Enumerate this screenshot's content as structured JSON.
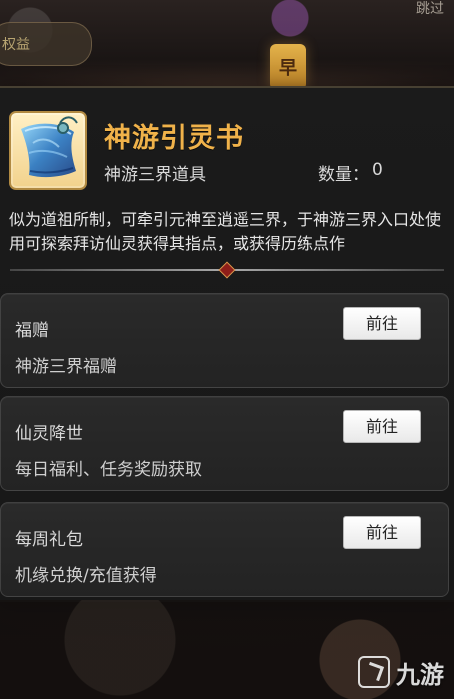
{
  "top": {
    "left_text": "权益",
    "right_text": "跳过",
    "tag_text": "早"
  },
  "item": {
    "name": "神游引灵书",
    "type": "神游三界道具",
    "quantity_label": "数量：",
    "quantity_value": "0",
    "icon_name": "scroll-icon",
    "description": "似为道祖所制，可牵引元神至逍遥三界，于神游三界入口处使用可探索拜访仙灵获得其指点，或获得历练点作"
  },
  "sources": [
    {
      "title": "福赠",
      "subtitle": "神游三界福赠",
      "button_label": "前往"
    },
    {
      "title": "仙灵降世",
      "subtitle": "每日福利、任务奖励获取",
      "button_label": "前往"
    },
    {
      "title": "每周礼包",
      "subtitle": "机缘兑换/充值获得",
      "button_label": "前往"
    }
  ],
  "watermark": {
    "text": "九游"
  },
  "colors": {
    "title_gold": "#f0b24a",
    "panel_bg": "#1b1b1b",
    "card_bg": "#2a2a2a",
    "button_bg": "#ffffff"
  }
}
